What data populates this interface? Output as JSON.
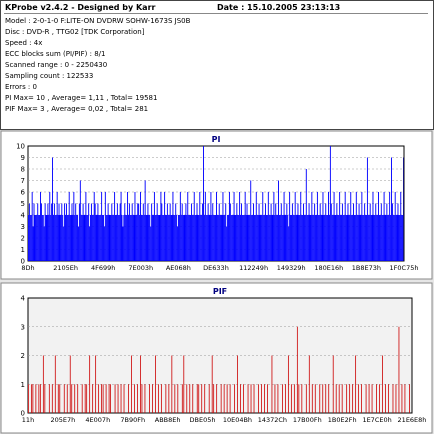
{
  "info": {
    "title": "KProbe v2.4.2 - Designed by Karr",
    "date": "Date : 15.10.2005 23:13:13",
    "lines": [
      "Model : 2-0-1-0 F:LITE-ON DVDRW SOHW-1673S JS0B",
      "Disc : DVD-R , TTG02 [TDK Corporation]",
      "Speed : 4x",
      "ECC blocks sum (PI/PIF) : 8/1",
      "Scanned range : 0 - 2250430",
      "Sampling count : 122533",
      "Errors : 0",
      "PI Max= 10 , Average= 1,11 , Total= 19581",
      "PIF Max= 3 , Average= 0,02 , Total= 281"
    ]
  },
  "chart_data": [
    {
      "type": "bar",
      "title": "PI",
      "ylim": [
        0,
        10
      ],
      "yticks": [
        "0",
        "1",
        "2",
        "3",
        "4",
        "5",
        "6",
        "7",
        "8",
        "9",
        "10"
      ],
      "xticks": [
        "8Dh",
        "2105Eh",
        "4F699h",
        "7E003h",
        "AE068h",
        "DE633h",
        "112249h",
        "149329h",
        "180E16h",
        "1B8E73h",
        "1F0C75h"
      ],
      "color": "#0000ff",
      "grid": true,
      "values": [
        4,
        5,
        4,
        4,
        6,
        3,
        5,
        4,
        4,
        4,
        5,
        4,
        4,
        6,
        5,
        4,
        4,
        3,
        5,
        4,
        4,
        5,
        4,
        6,
        4,
        5,
        9,
        4,
        5,
        4,
        4,
        6,
        4,
        5,
        4,
        4,
        5,
        4,
        3,
        5,
        4,
        5,
        4,
        4,
        6,
        4,
        4,
        5,
        4,
        6,
        4,
        5,
        4,
        4,
        3,
        5,
        7,
        4,
        4,
        5,
        4,
        4,
        6,
        4,
        4,
        5,
        3,
        4,
        5,
        4,
        4,
        6,
        5,
        4,
        4,
        5,
        4,
        4,
        4,
        6,
        4,
        4,
        3,
        6,
        4,
        4,
        5,
        4,
        4,
        4,
        5,
        4,
        4,
        6,
        4,
        4,
        5,
        4,
        4,
        5,
        6,
        4,
        3,
        4,
        5,
        4,
        4,
        6,
        4,
        5,
        4,
        4,
        5,
        4,
        4,
        6,
        4,
        4,
        5,
        5,
        4,
        6,
        4,
        4,
        5,
        4,
        7,
        4,
        4,
        5,
        4,
        4,
        3,
        5,
        4,
        4,
        6,
        4,
        4,
        5,
        4,
        4,
        4,
        6,
        5,
        4,
        4,
        6,
        4,
        4,
        5,
        4,
        4,
        5,
        4,
        4,
        6,
        4,
        4,
        5,
        4,
        3,
        4,
        4,
        6,
        4,
        5,
        4,
        4,
        4,
        5,
        4,
        6,
        4,
        4,
        4,
        5,
        4,
        4,
        6,
        4,
        4,
        5,
        4,
        4,
        6,
        4,
        4,
        5,
        10,
        4,
        6,
        4,
        4,
        5,
        4,
        4,
        6,
        4,
        5,
        4,
        4,
        4,
        6,
        4,
        4,
        5,
        4,
        4,
        4,
        6,
        4,
        4,
        5,
        3,
        4,
        4,
        6,
        5,
        4,
        4,
        4,
        6,
        4,
        4,
        5,
        4,
        4,
        6,
        4,
        5,
        4,
        4,
        4,
        6,
        4,
        5,
        4,
        4,
        4,
        7,
        4,
        4,
        5,
        4,
        4,
        6,
        4,
        4,
        5,
        4,
        4,
        4,
        6,
        4,
        4,
        5,
        4,
        4,
        6,
        4,
        4,
        5,
        4,
        4,
        6,
        4,
        5,
        4,
        4,
        7,
        4,
        4,
        5,
        4,
        4,
        6,
        4,
        4,
        5,
        4,
        3,
        6,
        4,
        4,
        5,
        4,
        4,
        6,
        4,
        4,
        5,
        4,
        4,
        6,
        4,
        4,
        5,
        4,
        4,
        8,
        4,
        4,
        5,
        4,
        4,
        6,
        4,
        4,
        5,
        4,
        4,
        6,
        4,
        4,
        5,
        4,
        4,
        6,
        4,
        4,
        5,
        4,
        4,
        6,
        4,
        10,
        5,
        4,
        4,
        6,
        4,
        4,
        5,
        4,
        4,
        6,
        4,
        4,
        5,
        4,
        4,
        6,
        4,
        4,
        5,
        4,
        4,
        6,
        4,
        4,
        5,
        4,
        4,
        6,
        4,
        4,
        5,
        4,
        4,
        6,
        4,
        4,
        5,
        4,
        4,
        9,
        4,
        4,
        5,
        4,
        4,
        6,
        4,
        4,
        5,
        4,
        4,
        6,
        4,
        4,
        5,
        4,
        4,
        6,
        4,
        4,
        5,
        4,
        4,
        6,
        4,
        9,
        5,
        4,
        4,
        6,
        4,
        4,
        5,
        4,
        4,
        6,
        4,
        4,
        9
      ]
    },
    {
      "type": "bar",
      "title": "PIF",
      "ylim": [
        0,
        4
      ],
      "yticks": [
        "0",
        "1",
        "2",
        "3",
        "4"
      ],
      "xticks": [
        "11h",
        "205E7h",
        "4E007h",
        "7B90Fh",
        "ABB8Eh",
        "DBE05h",
        "10E04Bh",
        "14372Ch",
        "17B00Fh",
        "1B0E2Fh",
        "1E7CE0h",
        "21E6E8h"
      ],
      "color": "#cc0000",
      "grid": true,
      "values": [
        1,
        0,
        1,
        1,
        0,
        1,
        0,
        1,
        1,
        0,
        2,
        1,
        0,
        0,
        1,
        0,
        1,
        0,
        2,
        0,
        1,
        1,
        0,
        0,
        1,
        0,
        1,
        0,
        2,
        1,
        0,
        1,
        0,
        1,
        0,
        0,
        1,
        0,
        1,
        1,
        0,
        2,
        0,
        1,
        0,
        2,
        0,
        1,
        0,
        1,
        1,
        0,
        1,
        0,
        1,
        1,
        0,
        0,
        1,
        0,
        1,
        0,
        1,
        0,
        1,
        0,
        0,
        1,
        0,
        2,
        0,
        1,
        0,
        1,
        0,
        2,
        1,
        0,
        1,
        0,
        0,
        1,
        0,
        1,
        0,
        2,
        0,
        1,
        0,
        1,
        0,
        0,
        1,
        0,
        1,
        0,
        2,
        0,
        1,
        0,
        1,
        0,
        0,
        1,
        2,
        0,
        1,
        0,
        1,
        0,
        1,
        0,
        0,
        1,
        1,
        0,
        1,
        0,
        1,
        0,
        0,
        1,
        0,
        2,
        1,
        0,
        1,
        0,
        0,
        1,
        0,
        1,
        0,
        1,
        0,
        1,
        0,
        0,
        1,
        0,
        2,
        0,
        1,
        0,
        1,
        0,
        0,
        1,
        0,
        1,
        0,
        1,
        0,
        0,
        1,
        0,
        1,
        0,
        1,
        0,
        1,
        0,
        0,
        2,
        0,
        1,
        0,
        1,
        0,
        0,
        1,
        0,
        1,
        0,
        2,
        0,
        1,
        0,
        1,
        0,
        3,
        1,
        0,
        1,
        0,
        0,
        1,
        0,
        2,
        0,
        1,
        0,
        1,
        0,
        0,
        1,
        0,
        1,
        0,
        1,
        0,
        1,
        0,
        0,
        2,
        0,
        1,
        0,
        1,
        0,
        1,
        0,
        0,
        1,
        0,
        1,
        0,
        1,
        0,
        2,
        0,
        1,
        0,
        1,
        0,
        0,
        1,
        0,
        1,
        0,
        1,
        0,
        0,
        1,
        0,
        1,
        0,
        2,
        0,
        1,
        0,
        1,
        0,
        0,
        1,
        0,
        1,
        0,
        3,
        0,
        1,
        0,
        1,
        0,
        0,
        1,
        0
      ]
    }
  ]
}
